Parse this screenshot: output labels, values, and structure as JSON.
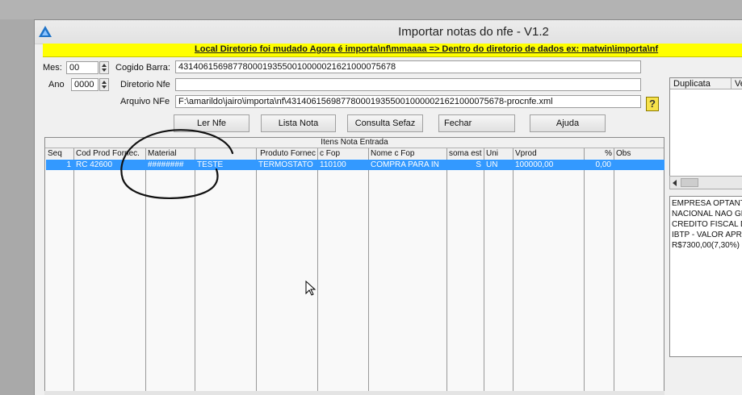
{
  "window": {
    "title": "Importar notas do nfe - V1.2",
    "banner": "Local Diretorio foi mudado Agora é importa\\nf\\mmaaaa  => Dentro do diretorio de dados ex: matwin\\importa\\nf",
    "banner_color": "#ffff00"
  },
  "form": {
    "mes_label": "Mes:",
    "mes_value": "00",
    "ano_label": "Ano",
    "ano_value": "0000",
    "codigo_barra_label": "Cogido Barra:",
    "codigo_barra_value": "43140615698778000193550010000021621000075678",
    "diretorio_label": "Diretorio Nfe",
    "diretorio_value": "",
    "arquivo_label": "Arquivo NFe",
    "arquivo_value": "F:\\amarildo\\jairo\\importa\\nf\\43140615698778000193550010000021621000075678-procnfe.xml"
  },
  "buttons": {
    "ler_nfe": "Ler Nfe",
    "lista_nota": "Lista Nota",
    "consulta_sefaz": "Consulta Sefaz",
    "fechar": "Fechar",
    "ajuda": "Ajuda",
    "help_glyph": "?"
  },
  "grid": {
    "title": "Itens Nota Entrada",
    "columns": [
      "Seq",
      "Cod Prod Fornec.",
      "Material",
      "",
      "Produto Fornec",
      "c Fop",
      "Nome c Fop",
      "soma est",
      "Uni",
      "Vprod",
      "%",
      "Obs"
    ],
    "rows": [
      [
        "1",
        "RC 42600",
        "########",
        "TESTE",
        "TERMOSTATO",
        "110100",
        "COMPRA PARA IN",
        "S",
        "UN",
        "100000,00",
        "0,00",
        ""
      ]
    ],
    "selected_color": "#3399ff"
  },
  "side": {
    "headers": [
      "Duplicata",
      "Ve"
    ],
    "memo_lines": [
      "EMPRESA OPTANTE",
      "NACIONAL NAO GERA",
      "CREDITO FISCAL DE",
      "IBTP - VALOR APROX",
      "R$7300,00(7,30%)"
    ]
  },
  "icons": {
    "app": "app-triangle-icon",
    "help": "help-question-icon",
    "cursor": "mouse-pointer-icon"
  }
}
